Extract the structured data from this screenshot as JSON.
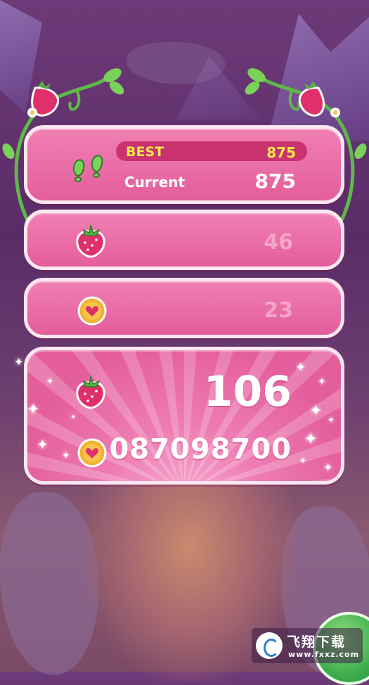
{
  "score": {
    "best_label": "BEST",
    "best_value": "875",
    "current_label": "Current",
    "current_value": "875",
    "steps_icon": "footsteps-icon"
  },
  "berries": {
    "value": "46",
    "icon": "strawberry-icon"
  },
  "coins": {
    "value": "23",
    "icon": "heart-coin-icon"
  },
  "total": {
    "berries_value": "106",
    "coins_value": "087098700",
    "berries_icon": "strawberry-icon",
    "coins_icon": "heart-coin-icon"
  },
  "watermark": {
    "title": "飞翔下载",
    "url": "www.fxxz.com"
  },
  "colors": {
    "panel": "#e45e9c",
    "panel_border": "#fbe7f1",
    "best_text": "#ffe94a",
    "best_bar": "#c9336f",
    "faded_text": "#f6a3c8",
    "play_button": "#3fae4f"
  }
}
